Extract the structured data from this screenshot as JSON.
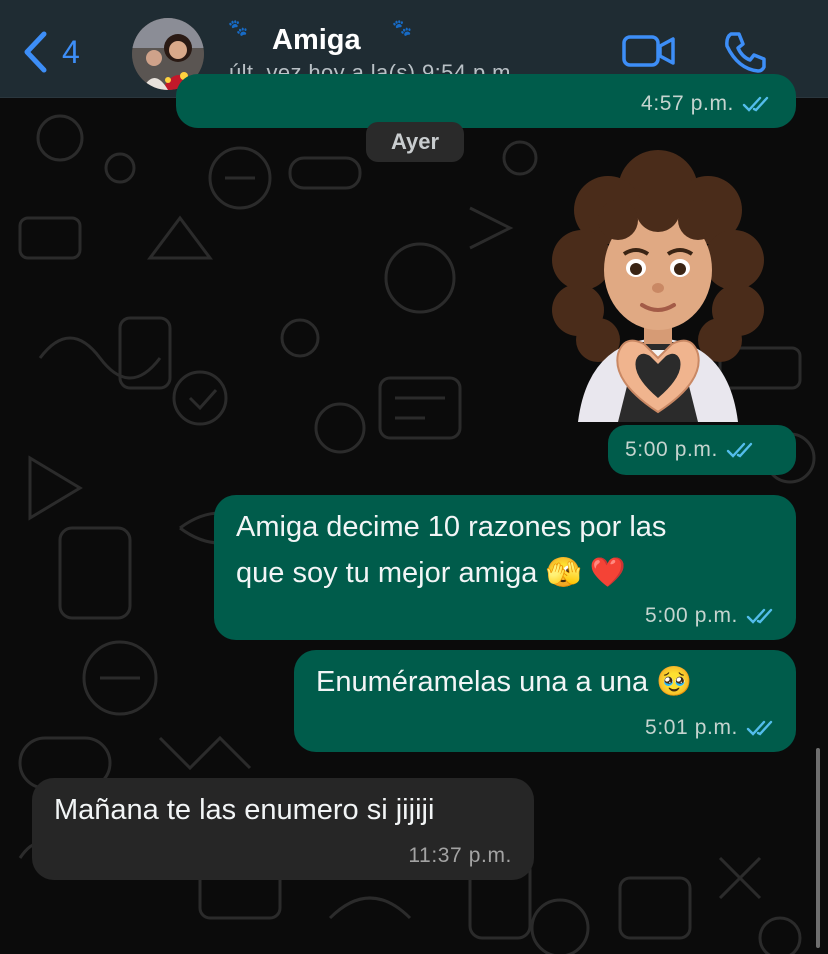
{
  "header": {
    "back_count": "4",
    "contact_name": "Amiga",
    "last_seen": "últ. vez hoy a la(s) 9:54 p.m.",
    "icons": {
      "back": "chevron-left-icon",
      "video": "video-camera-icon",
      "call": "phone-icon"
    }
  },
  "chat": {
    "date_separator": "Ayer",
    "messages": [
      {
        "direction": "out",
        "time": "4:57 p.m.",
        "status": "read"
      },
      {
        "direction": "out",
        "type": "sticker",
        "sticker": "memoji-heart-hands",
        "time": "5:00 p.m.",
        "status": "read"
      },
      {
        "direction": "out",
        "lines": [
          "Amiga  decime 10 razones por las",
          "que soy tu mejor amiga 🫣 ❤️"
        ],
        "time": "5:00 p.m.",
        "status": "read"
      },
      {
        "direction": "out",
        "lines": [
          "Enuméramelas una a una 🥹"
        ],
        "time": "5:01 p.m.",
        "status": "read"
      },
      {
        "direction": "in",
        "lines": [
          "Mañana te las enumero si jijiji"
        ],
        "time": "11:37 p.m."
      }
    ]
  },
  "colors": {
    "outgoing_bubble": "#005c4b",
    "incoming_bubble": "#262626",
    "accent_blue": "#3d8ef7",
    "read_ticks": "#53bdeb"
  }
}
